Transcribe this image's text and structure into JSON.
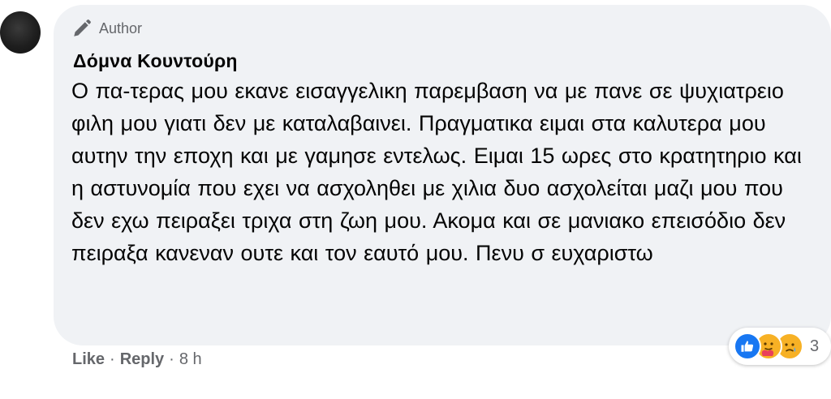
{
  "comment": {
    "badge_label": "Author",
    "author_name": "Δόμνα Κουντούρη",
    "text": "Ο πα-τερας μου εκανε εισαγγελικη παρεμβαση να με πανε σε ψυχιατρειο φιλη μου γιατι δεν με καταλαβαινει. Πραγματικα ειμαι στα καλυτερα μου αυτην την εποχη και με γαμησε εντελως. Ειμαι 15 ωρες στο κρατητηριο και η αστυνομία που εχει να ασχοληθει με χιλια δυο ασχολείται μαζι μου που δεν εχω πειραξει τριχα στη ζωη μου. Ακομα και σε μανιακο επεισόδιο δεν πειραξα κανεναν ουτε και τον εαυτό μου. Πενυ σ ευχαριστω"
  },
  "actions": {
    "like_label": "Like",
    "reply_label": "Reply",
    "separator": "·",
    "time": "8 h"
  },
  "reactions": {
    "icons": [
      "like-icon",
      "care-icon",
      "sad-icon"
    ],
    "count": "3"
  },
  "colors": {
    "bubble_bg": "#f0f2f5",
    "text": "#050505",
    "secondary": "#65676b",
    "like_blue": "#1877f2",
    "emoji_yellow": "#f7b125"
  }
}
